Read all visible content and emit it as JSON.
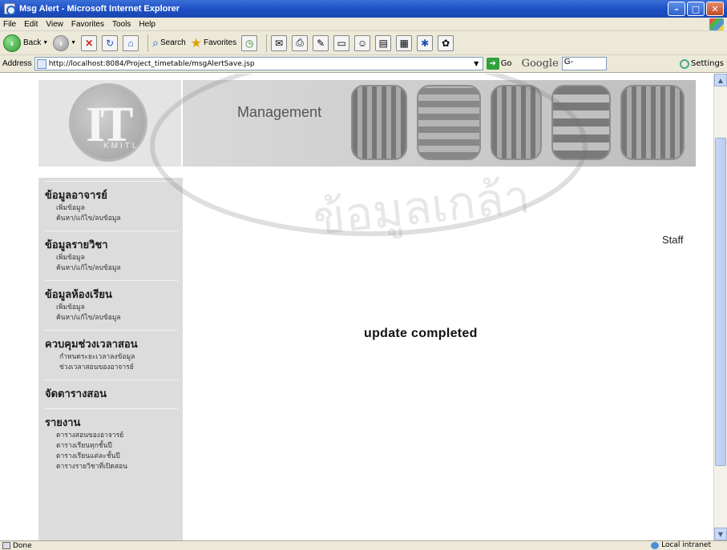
{
  "window": {
    "title": "Msg Alert - Microsoft Internet Explorer"
  },
  "menubar": [
    "File",
    "Edit",
    "View",
    "Favorites",
    "Tools",
    "Help"
  ],
  "toolbar": {
    "back": "Back",
    "search": "Search",
    "favorites": "Favorites"
  },
  "addressbar": {
    "label": "Address",
    "url": "http://localhost:8084/Project_timetable/msgAlertSave.jsp",
    "go": "Go",
    "google": "Google",
    "google_box": "G-",
    "settings": "Settings"
  },
  "banner": {
    "logo": "IT",
    "logo_sub": "KMITL",
    "title": "Management"
  },
  "sidebar": [
    {
      "title": "ข้อมูลอาจารย์",
      "links": [
        "เพิ่มข้อมูล",
        "ค้นหา/แก้ไข/ลบข้อมูล"
      ]
    },
    {
      "title": "ข้อมูลรายวิชา",
      "links": [
        "เพิ่มข้อมูล",
        "ค้นหา/แก้ไข/ลบข้อมูล"
      ]
    },
    {
      "title": "ข้อมูลห้องเรียน",
      "links": [
        "เพิ่มข้อมูล",
        "ค้นหา/แก้ไข/ลบข้อมูล"
      ]
    },
    {
      "title": "ควบคุมช่วงเวลาสอน",
      "links": [
        "กำหนดระยะเวลาลงข้อมูล",
        "ช่วงเวลาสอนของอาจารย์"
      ]
    },
    {
      "title": "จัดตารางสอน",
      "links": []
    },
    {
      "title": "รายงาน",
      "links": [
        "ตารางสอนของอาจารย์",
        "ตารางเรียนทุกชั้นปี",
        "ตารางเรียนแต่ละชั้นปี",
        "ตารางรายวิชาที่เปิดสอน"
      ]
    }
  ],
  "main": {
    "user": "Staff",
    "message": "update completed"
  },
  "statusbar": {
    "status": "Done",
    "zone": "Local intranet"
  },
  "watermark": "ข้อมูลเกล้า"
}
